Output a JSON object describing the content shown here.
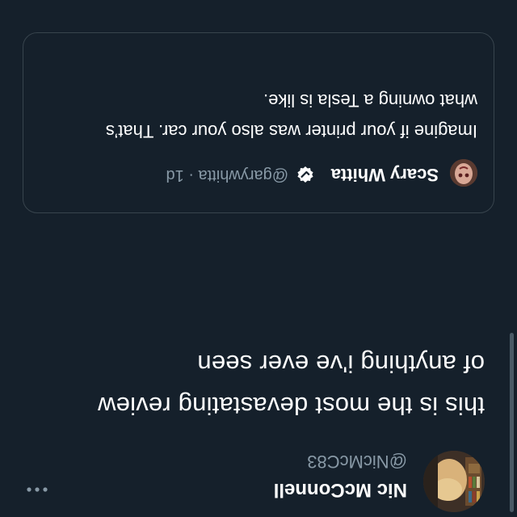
{
  "tweet": {
    "author_name": "Nic McConnell",
    "author_handle": "@NicMcC83",
    "more_icon": "more-horizontal-icon",
    "text_lines": [
      "this is the most devastating review",
      "of anything i've ever seen"
    ]
  },
  "quoted_tweet": {
    "author_name": "Scary Whitta",
    "verified_icon": "verified-badge-icon",
    "meta": "@garywhitta · 1d",
    "text_lines": [
      "Imagine if your printer was also your car. That’s",
      "what owning a Tesla is like."
    ]
  },
  "colors": {
    "background": "#15202b",
    "text": "#ffffff",
    "secondary_text": "#8899a6",
    "border": "#38444d",
    "verified_badge": "#ffffff"
  }
}
